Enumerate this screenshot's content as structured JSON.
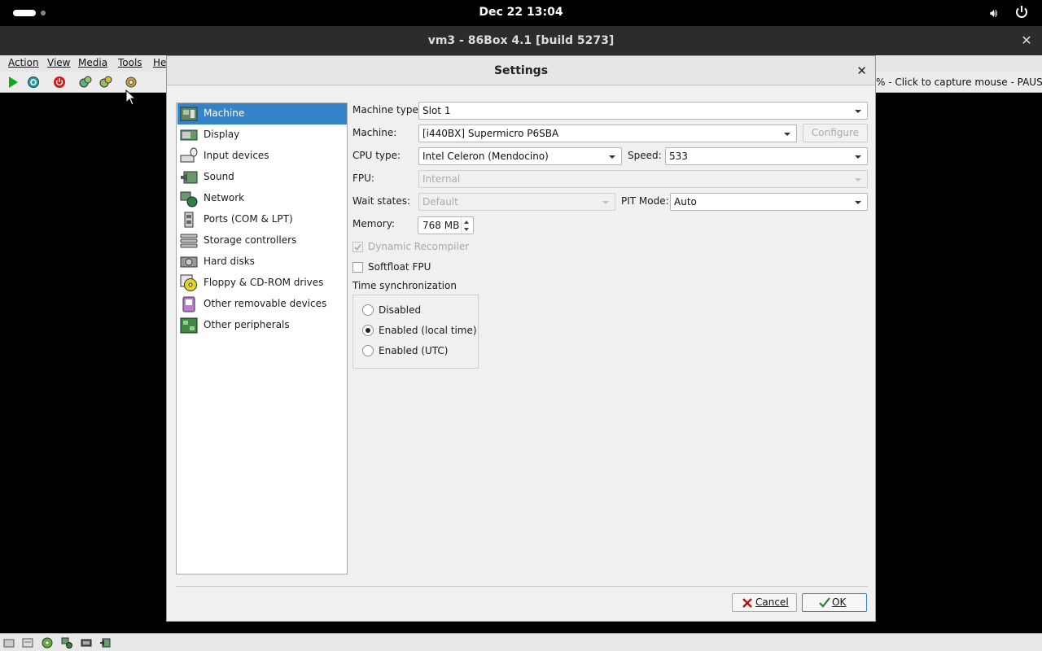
{
  "topbar": {
    "clock": "Dec 22  13:04"
  },
  "window": {
    "title": "vm3 - 86Box 4.1 [build 5273]",
    "menus": [
      "Action",
      "View",
      "Media",
      "Tools",
      "He"
    ],
    "status_text": "% - Click to capture mouse - PAUSED"
  },
  "dialog": {
    "title": "Settings",
    "nav": [
      {
        "label": "Machine",
        "icon": "motherboard-icon",
        "selected": true
      },
      {
        "label": "Display",
        "icon": "display-card-icon"
      },
      {
        "label": "Input devices",
        "icon": "input-devices-icon"
      },
      {
        "label": "Sound",
        "icon": "sound-card-icon"
      },
      {
        "label": "Network",
        "icon": "network-icon"
      },
      {
        "label": "Ports (COM & LPT)",
        "icon": "ports-icon"
      },
      {
        "label": "Storage controllers",
        "icon": "storage-controller-icon"
      },
      {
        "label": "Hard disks",
        "icon": "hard-disk-icon"
      },
      {
        "label": "Floppy & CD-ROM drives",
        "icon": "floppy-cdrom-icon"
      },
      {
        "label": "Other removable devices",
        "icon": "removable-device-icon"
      },
      {
        "label": "Other peripherals",
        "icon": "peripherals-icon"
      }
    ],
    "machine": {
      "machine_type_label": "Machine type:",
      "machine_type": "Slot 1",
      "machine_label": "Machine:",
      "machine": "[i440BX] Supermicro P6SBA",
      "configure": "Configure",
      "cpu_type_label": "CPU type:",
      "cpu_type": "Intel Celeron (Mendocino)",
      "speed_label": "Speed:",
      "speed": "533",
      "fpu_label": "FPU:",
      "fpu": "Internal",
      "wait_states_label": "Wait states:",
      "wait_states": "Default",
      "pit_mode_label": "PIT Mode:",
      "pit_mode": "Auto",
      "memory_label": "Memory:",
      "memory": "768 MB",
      "dynamic_recompiler": "Dynamic Recompiler",
      "softfloat_fpu": "Softfloat FPU",
      "time_sync_label": "Time synchronization",
      "time_sync_options": [
        "Disabled",
        "Enabled (local time)",
        "Enabled (UTC)"
      ],
      "time_sync_selected": "Enabled (local time)"
    },
    "cancel": "Cancel",
    "ok": "OK"
  }
}
